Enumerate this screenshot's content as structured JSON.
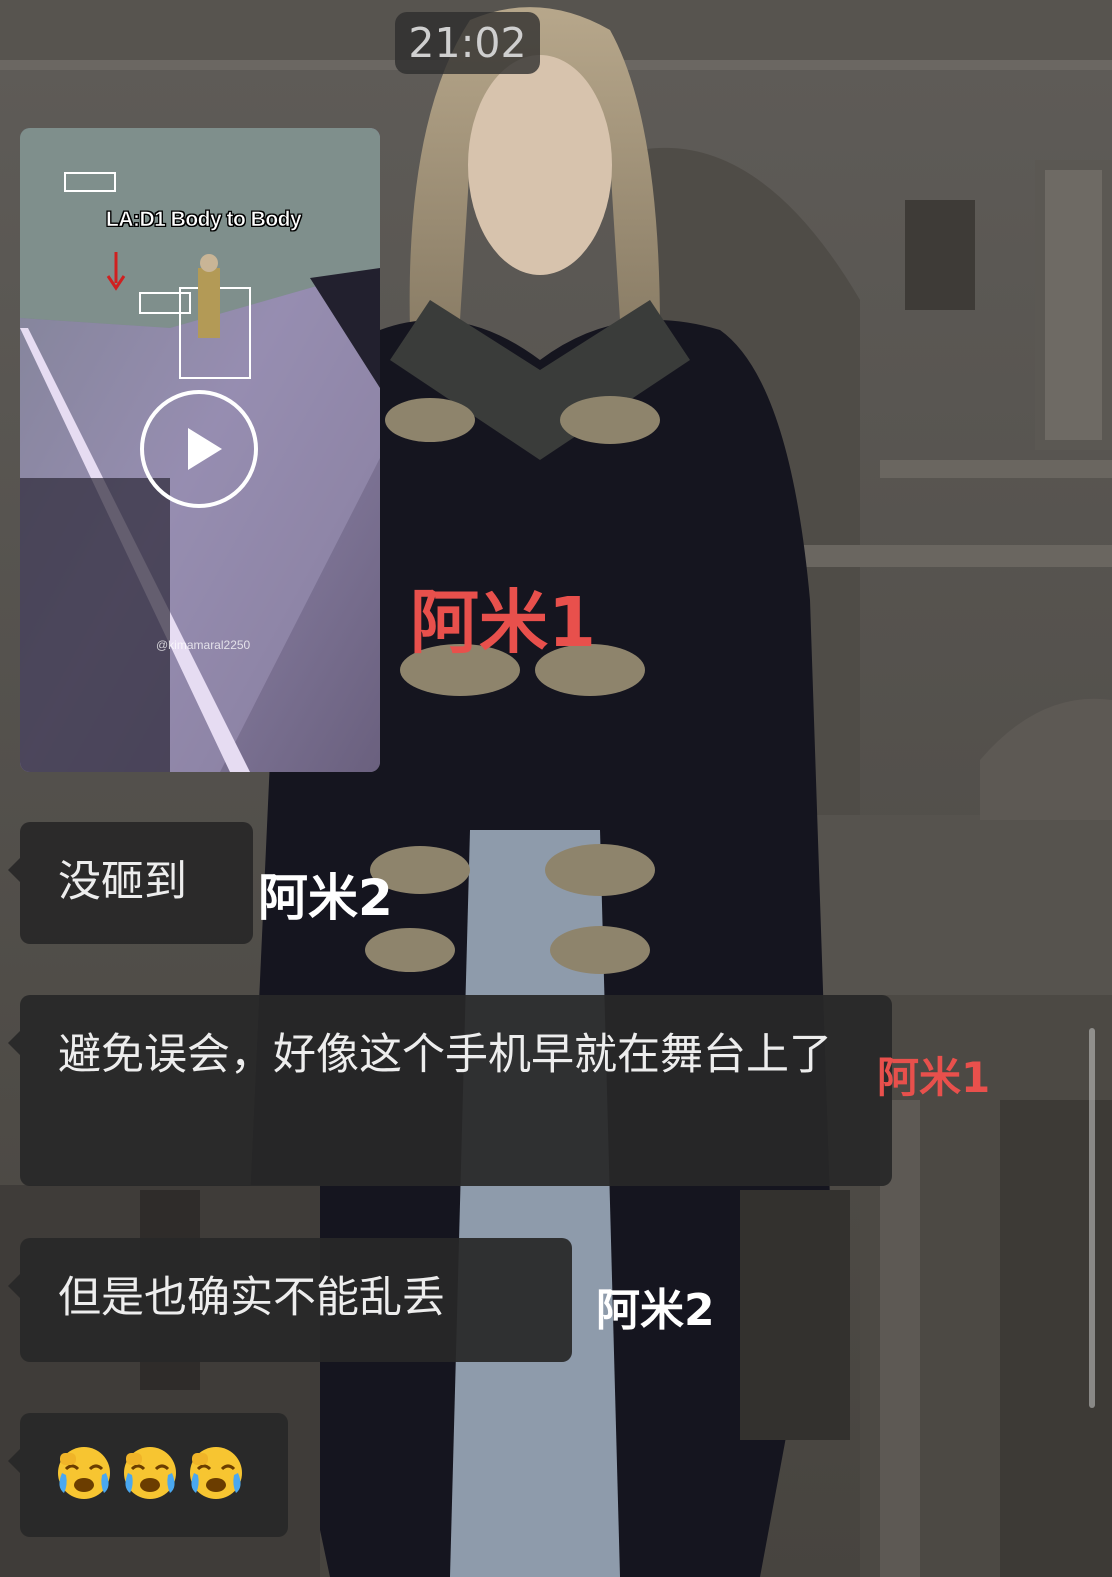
{
  "status": {
    "time": "21:02"
  },
  "messages": [
    {
      "type": "video",
      "caption": "LA:D1 Body to Body",
      "watermark": "@kimamaral2250",
      "play_icon": "play-icon"
    },
    {
      "type": "text",
      "text": "没砸到",
      "tag": "阿米2"
    },
    {
      "type": "text",
      "text": "避免误会，好像这个手机早就在舞台上了",
      "tag": "阿米1"
    },
    {
      "type": "text",
      "text": "但是也确实不能乱丢",
      "tag": "阿米2"
    },
    {
      "type": "emoji",
      "emojis": [
        "crying-face-icon",
        "crying-face-icon",
        "crying-face-icon"
      ]
    }
  ],
  "overlay_tags": {
    "center": "阿米1"
  },
  "colors": {
    "bubble": "#282828",
    "tag_red": "#e8504c",
    "tag_white": "#ffffff",
    "time_text": "#cfcfcf"
  }
}
